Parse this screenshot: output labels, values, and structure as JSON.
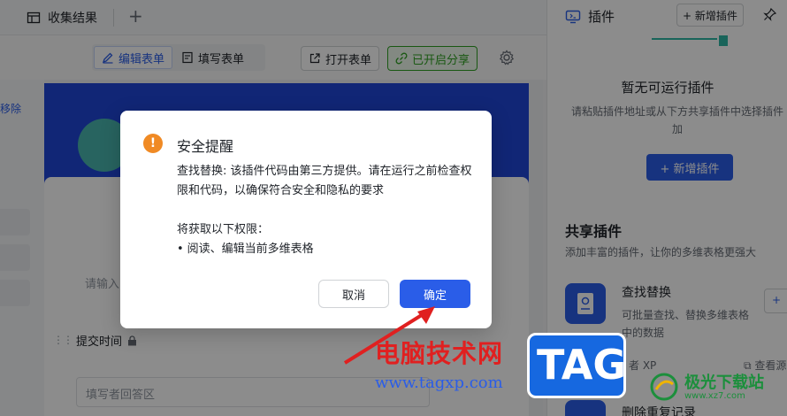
{
  "topbar": {
    "tab_label": "收集结果",
    "new_tab": "+"
  },
  "toolbar": {
    "edit_form": "编辑表单",
    "fill_form": "填写表单",
    "open_form": "打开表单",
    "share_enabled": "已开启分享"
  },
  "left": {
    "remove_label": "移除"
  },
  "form": {
    "input_placeholder_partial": "请输入",
    "field_label": "提交时间",
    "field_placeholder": "填写者回答区"
  },
  "plugin_panel": {
    "title": "插件",
    "add_button": "+ 新增插件",
    "empty_title": "暂无可运行插件",
    "empty_hint": "请粘贴插件地址或从下方共享插件中选择插件加",
    "add_primary": "+ 新增插件",
    "share_title": "共享插件",
    "share_desc": "添加丰富的插件，让你的多维表格更强大",
    "plugin1": {
      "name": "查找替换",
      "desc": "可批量查找、替换多维表格中的数据",
      "add": "+",
      "author": "者 XP",
      "view": "查看源"
    },
    "plugin2": {
      "name": "删除重复记录"
    }
  },
  "dialog": {
    "title": "安全提醒",
    "message": "查找替换: 该插件代码由第三方提供。请在运行之前检查权限和代码，以确保符合安全和隐私的要求",
    "permissions_heading": "将获取以下权限：",
    "permissions": [
      "阅读、编辑当前多维表格"
    ],
    "cancel": "取消",
    "confirm": "确定",
    "warning_glyph": "!"
  },
  "watermark": {
    "site_name": "电脑技术网",
    "site_url": "www.tagxp.com",
    "tag": "TAG",
    "logo_name": "极光下载站",
    "logo_url": "www.xz7.com"
  },
  "colors": {
    "accent": "#2a5de8",
    "warning": "#f08a24",
    "share_green": "#2ea121",
    "watermark_red": "#e02020"
  }
}
